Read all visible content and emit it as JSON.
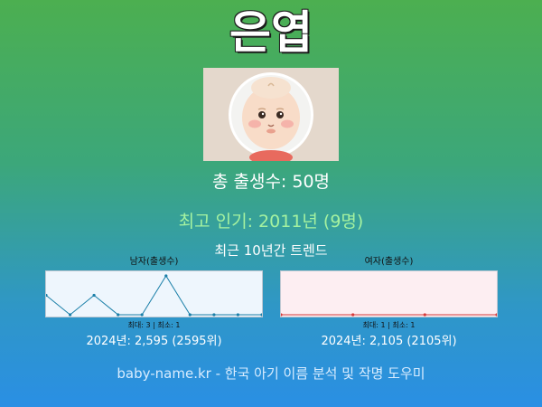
{
  "name": "은엽",
  "total_births": "총 출생수: 50명",
  "peak_popularity": "최고 인기: 2011년 (9명)",
  "trend_title": "최근 10년간 트렌드",
  "male": {
    "label": "남자(출생수)",
    "stats": "최대: 3 | 최소: 1",
    "rank_2024": "2024년: 2,595 (2595위)",
    "line_color": "#1a7fa8",
    "bg_color": "#eef6fd"
  },
  "female": {
    "label": "여자(출생수)",
    "stats": "최대: 1 | 최소: 1",
    "rank_2024": "2024년: 2,105 (2105위)",
    "line_color": "#d43a3a",
    "bg_color": "#fdeef2"
  },
  "footer": "baby-name.kr - 한국 아기 이름 분석 및 작명 도우미",
  "chart_data": [
    {
      "type": "line",
      "title": "남자(출생수)",
      "x": [
        1,
        2,
        3,
        4,
        5,
        6,
        7,
        8,
        9,
        10
      ],
      "values": [
        2,
        1,
        2,
        1,
        1,
        3,
        1,
        1,
        1,
        1
      ],
      "ylim": [
        1,
        3
      ]
    },
    {
      "type": "line",
      "title": "여자(출생수)",
      "x": [
        1,
        2,
        3,
        4
      ],
      "values": [
        1,
        1,
        1,
        1
      ],
      "ylim": [
        1,
        1
      ]
    }
  ]
}
